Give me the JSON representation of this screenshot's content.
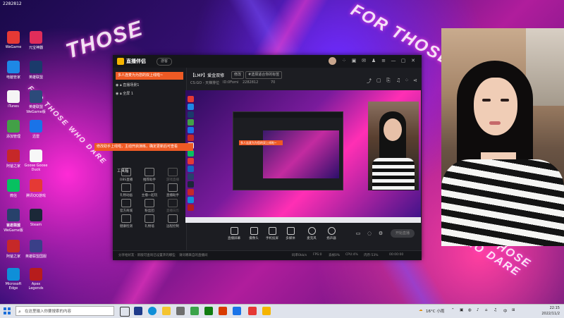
{
  "desktop": {
    "user_id": "2282812",
    "watermark_top": "THOSE",
    "watermark_right": "FOR THOSE",
    "watermark_left": "FOR THOSE WHO DARE",
    "watermark_br": "FOR THOSE WHO DARE",
    "icons": [
      {
        "label": "WeGame",
        "color": "#e53935"
      },
      {
        "label": "元宝神器",
        "color": "#e02d5a"
      },
      {
        "label": "电脑管家",
        "color": "#1e88e5"
      },
      {
        "label": "英雄联盟",
        "color": "#1b3a6b"
      },
      {
        "label": "iTunes",
        "color": "#f5f5f5"
      },
      {
        "label": "英雄联盟WeGame版",
        "color": "#2c4a7a"
      },
      {
        "label": "添加管理",
        "color": "#43a047"
      },
      {
        "label": "迅雷",
        "color": "#1a73e8"
      },
      {
        "label": "阿爸之家",
        "color": "#c62828"
      },
      {
        "label": "Goose Goose Duck",
        "color": "#f7f7f7"
      },
      {
        "label": "微信",
        "color": "#07c160"
      },
      {
        "label": "腾讯QQ游戏",
        "color": "#e53935"
      },
      {
        "label": "官方商城",
        "color": "#1565c0"
      },
      {
        "label": "英雄联盟WeGame版",
        "color": "#27416b"
      },
      {
        "label": "Steam",
        "color": "#1b2838"
      },
      {
        "label": "阿爸之家",
        "color": "#c62828"
      },
      {
        "label": "英雄联盟国服",
        "color": "#3a3f88"
      },
      {
        "label": "Microsoft Edge",
        "color": "#0f8fd8"
      },
      {
        "label": "Apex Legends",
        "color": "#b71c1c"
      }
    ]
  },
  "app": {
    "name": "直播伴侣",
    "badge": "游客",
    "title_icons": [
      "grid-icon",
      "cube-icon",
      "mail-icon",
      "shirt-icon",
      "settings-icon",
      "minimize-icon",
      "maximize-icon",
      "close-icon"
    ],
    "left": {
      "banner": "多人连麦为为您的双上线啦~",
      "scenes": [
        {
          "label": "直播场景1"
        },
        {
          "label": "全屏 1"
        }
      ],
      "toolbox_title": "工具箱",
      "tools": [
        {
          "label": "OBS直播",
          "dim": false
        },
        {
          "label": "推荐助手",
          "dim": false
        },
        {
          "label": "游戏直播",
          "dim": true
        },
        {
          "label": "礼物动画",
          "dim": false
        },
        {
          "label": "主播一起玩",
          "dim": false
        },
        {
          "label": "直播助手",
          "dim": false
        },
        {
          "label": "官方商城",
          "dim": false
        },
        {
          "label": "粉丝团",
          "dim": false
        },
        {
          "label": "直播日历",
          "dim": true
        },
        {
          "label": "健康检测",
          "dim": false
        },
        {
          "label": "礼物墙",
          "dim": false
        },
        {
          "label": "远程控制",
          "dim": false
        }
      ]
    },
    "tooltip": "修改助手上线啦，主动开启演练，确定更新后可查看",
    "header": {
      "title": "【LMP】爱金双修",
      "tag1": "修改",
      "tag2": "#选择适合你的标签",
      "sub1": "CS:GO - 天梯排位",
      "sub2": "ID:0Fomi",
      "sub3": "2282812",
      "sub4": "70"
    },
    "nested_banner": "多人连麦为为您的双上线啦~",
    "controls": [
      {
        "label": "直播屏幕"
      },
      {
        "label": "摄像头"
      },
      {
        "label": "手机投屏"
      },
      {
        "label": "多媒体"
      },
      {
        "label": "麦克风"
      },
      {
        "label": "扬声器"
      }
    ],
    "start_label": "开始直播",
    "status": {
      "s1": "分享给好友 · 新版可查询已设置开的哪些",
      "s2": "请问哪来自的直播间",
      "s3": "码率0kb/s",
      "s4": "FPS:0",
      "s5": "丢帧0%",
      "s6": "CPU:4%",
      "s7": "内存:53%",
      "s8": "00:00:00"
    }
  },
  "taskbar": {
    "search_placeholder": "在这里输入你要搜索的内容",
    "weather": "16°C 小雨",
    "lang": "中",
    "time": "22:15",
    "date": "2022/11/2"
  }
}
